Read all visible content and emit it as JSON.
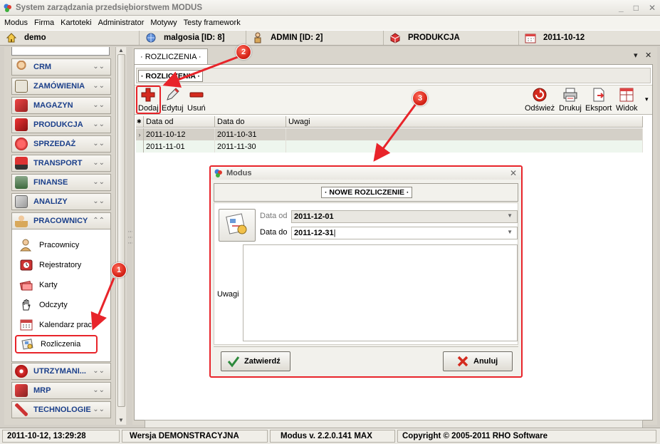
{
  "window": {
    "title": "System zarządzania przedsiębiorstwem MODUS"
  },
  "menu": [
    "Modus",
    "Firma",
    "Kartoteki",
    "Administrator",
    "Motywy",
    "Testy framework"
  ],
  "infobar": {
    "company": "demo",
    "user1": "malgosia [ID: 8]",
    "user2": "ADMIN [ID: 2]",
    "module": "PRODUKCJA",
    "date": "2011-10-12"
  },
  "sidebar": {
    "items": [
      "CRM",
      "ZAMÓWIENIA",
      "MAGAZYN",
      "PRODUKCJA",
      "SPRZEDAŻ",
      "TRANSPORT",
      "FINANSE",
      "ANALIZY",
      "PRACOWNICY"
    ],
    "sub_items": [
      "Pracownicy",
      "Rejestratory",
      "Karty",
      "Odczyty",
      "Kalendarz prac",
      "Rozliczenia"
    ],
    "bottom_items": [
      "UTRZYMANI...",
      "MRP",
      "TECHNOLOGIE"
    ]
  },
  "tab": {
    "label": "· ROZLICZENIA ·"
  },
  "subtab": {
    "label": "· ROZLICZENIA ·"
  },
  "toolbar": {
    "add": "Dodaj",
    "edit": "Edytuj",
    "delete": "Usuń",
    "refresh": "Odśwież",
    "print": "Drukuj",
    "export": "Eksport",
    "view": "Widok"
  },
  "grid": {
    "columns": [
      "Data od",
      "Data do",
      "Uwagi"
    ],
    "rows": [
      [
        "2011-10-12",
        "2011-10-31",
        ""
      ],
      [
        "2011-11-01",
        "2011-11-30",
        ""
      ]
    ]
  },
  "dialog": {
    "title": "Modus",
    "header": "· NOWE ROZLICZENIE ·",
    "date_from_label": "Data od",
    "date_from_value": "2011-12-01",
    "date_to_label": "Data do",
    "date_to_value": "2011-12-31",
    "notes_label": "Uwagi",
    "confirm": "Zatwierdź",
    "cancel": "Anuluj"
  },
  "markers": [
    "1",
    "2",
    "3"
  ],
  "statusbar": {
    "datetime": "2011-10-12,  13:29:28",
    "version_label": "Wersja DEMONSTRACYJNA",
    "app_version": "Modus v. 2.2.0.141 MAX",
    "copyright": "Copyright © 2005-2011 RHO Software"
  },
  "colors": {
    "highlight": "#e8242a",
    "nav_text": "#1b3f8a",
    "selected_row": "#d4d0c8"
  }
}
